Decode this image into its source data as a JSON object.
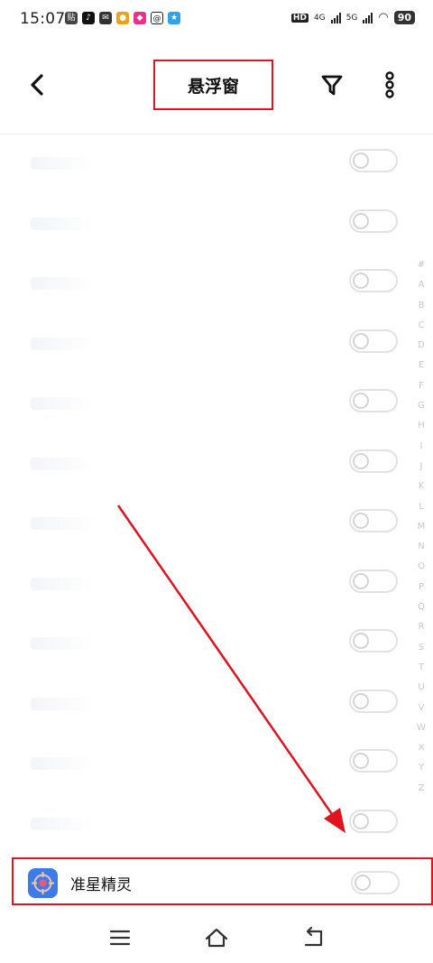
{
  "status_bar": {
    "time": "15:07",
    "network_hd": "HD",
    "network_4g": "4G",
    "network_5g": "5G",
    "battery": "90"
  },
  "header": {
    "title": "悬浮窗"
  },
  "alphabet_index": [
    "#",
    "A",
    "B",
    "C",
    "D",
    "E",
    "F",
    "G",
    "H",
    "I",
    "J",
    "K",
    "L",
    "M",
    "N",
    "O",
    "P",
    "Q",
    "R",
    "S",
    "T",
    "U",
    "V",
    "W",
    "X",
    "Y",
    "Z"
  ],
  "rows": [
    {
      "enabled": false
    },
    {
      "enabled": false
    },
    {
      "enabled": false
    },
    {
      "enabled": false
    },
    {
      "enabled": false
    },
    {
      "enabled": false
    },
    {
      "enabled": false
    },
    {
      "enabled": false
    },
    {
      "enabled": false
    },
    {
      "enabled": false
    },
    {
      "enabled": false
    },
    {
      "enabled": false
    }
  ],
  "highlighted_app": {
    "label": "准星精灵",
    "enabled": false
  },
  "colors": {
    "highlight": "#e0131e",
    "app_icon": "#3d7ce8"
  }
}
